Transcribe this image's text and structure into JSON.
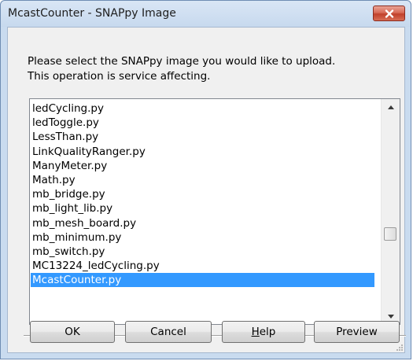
{
  "window": {
    "title": "McastCounter - SNAPpy Image",
    "close_icon": "close-icon"
  },
  "message": {
    "line1": "Please select the SNAPpy image you would like to upload.",
    "line2": "This operation is service affecting."
  },
  "list": {
    "items": [
      "ledCycling.py",
      "ledToggle.py",
      "LessThan.py",
      "LinkQualityRanger.py",
      "ManyMeter.py",
      "Math.py",
      "mb_bridge.py",
      "mb_light_lib.py",
      "mb_mesh_board.py",
      "mb_minimum.py",
      "mb_switch.py",
      "MC13224_ledCycling.py",
      "McastCounter.py"
    ],
    "selected": "McastCounter.py"
  },
  "buttons": {
    "ok": "OK",
    "cancel": "Cancel",
    "help": "Help",
    "preview": "Preview"
  },
  "colors": {
    "selection": "#3399ff",
    "close_button": "#c7432f",
    "titlebar": "#c9dbef"
  }
}
